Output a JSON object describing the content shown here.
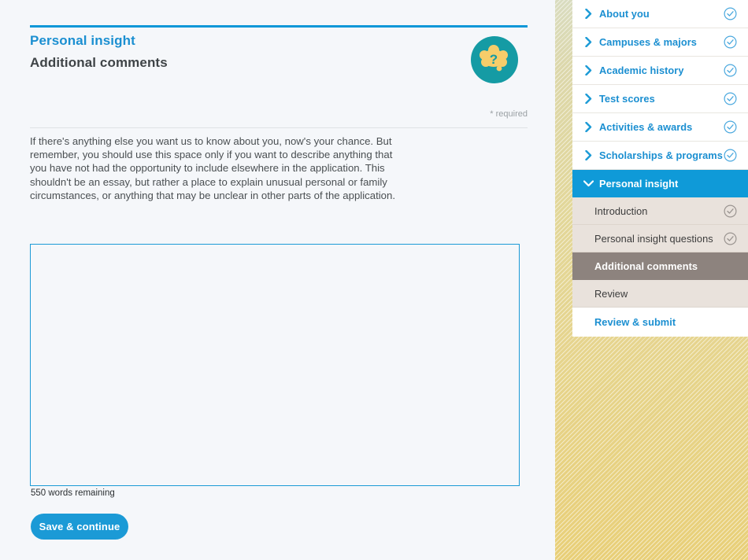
{
  "page": {
    "kicker": "Personal insight",
    "title": "Additional comments",
    "required_note": "* required",
    "help_icon": "thought-bubble-question-icon",
    "intro_text": "If there's anything else you want us to know about you, now's your chance. But remember, you should use this space only if you want to describe anything that you have not had the opportunity to include elsewhere in the application. This shouldn't be an essay, but rather a place to explain unusual personal or family circumstances, or anything that may be unclear in other parts of the application.",
    "comments": {
      "value": "",
      "placeholder": ""
    },
    "word_count": "550 words remaining",
    "save_label": "Save & continue"
  },
  "nav": {
    "sections": [
      {
        "label": "About you",
        "icon": "chevron-right-icon",
        "status": "check-circle-icon",
        "state": "collapsed"
      },
      {
        "label": "Campuses & majors",
        "icon": "chevron-right-icon",
        "status": "check-circle-icon",
        "state": "collapsed"
      },
      {
        "label": "Academic history",
        "icon": "chevron-right-icon",
        "status": "check-circle-icon",
        "state": "collapsed"
      },
      {
        "label": "Test scores",
        "icon": "chevron-right-icon",
        "status": "check-circle-icon",
        "state": "collapsed"
      },
      {
        "label": "Activities & awards",
        "icon": "chevron-right-icon",
        "status": "check-circle-icon",
        "state": "collapsed"
      },
      {
        "label": "Scholarships & programs",
        "icon": "chevron-right-icon",
        "status": "check-circle-icon",
        "state": "collapsed"
      }
    ],
    "expanded_section": {
      "label": "Personal insight",
      "icon": "chevron-down-icon"
    },
    "sub_items": [
      {
        "label": "Introduction",
        "status": "check-circle-icon",
        "state": "done"
      },
      {
        "label": "Personal insight questions",
        "status": "check-circle-icon",
        "state": "done"
      },
      {
        "label": "Additional comments",
        "status": "",
        "state": "current"
      },
      {
        "label": "Review",
        "status": "",
        "state": "pending"
      }
    ],
    "final_item": {
      "label": "Review & submit"
    }
  },
  "colors": {
    "brand_blue": "#1b9ad6",
    "header_blue": "#0f9ad8",
    "link_blue": "#1b8fd1",
    "current_nav": "#8d837e",
    "sub_nav_bg": "#e9e2dc",
    "gold_bg": "#e2d79a",
    "teal_badge": "#159ba4",
    "badge_bubble": "#f6cd6a",
    "content_bg": "#f5f7fa"
  }
}
